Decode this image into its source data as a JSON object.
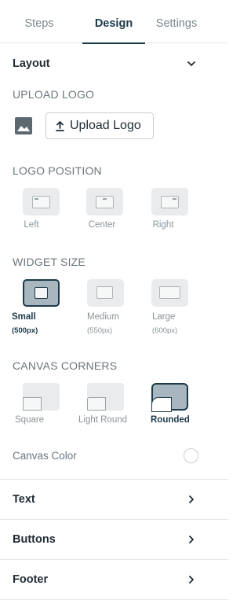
{
  "tabs": [
    {
      "label": "Steps",
      "active": false
    },
    {
      "label": "Design",
      "active": true
    },
    {
      "label": "Settings",
      "active": false
    }
  ],
  "layout_section": {
    "label": "Layout",
    "icon": "chevron-down-icon",
    "expanded": true
  },
  "upload_logo": {
    "heading": "UPLOAD LOGO",
    "image_icon": "image-icon",
    "button_label": "Upload Logo",
    "button_icon": "upload-icon"
  },
  "logo_position": {
    "heading": "LOGO POSITION",
    "options": [
      {
        "label": "Left",
        "selected": false
      },
      {
        "label": "Center",
        "selected": false
      },
      {
        "label": "Right",
        "selected": false
      }
    ]
  },
  "widget_size": {
    "heading": "WIDGET SIZE",
    "options": [
      {
        "label": "Small",
        "sub": "(500px)",
        "selected": true
      },
      {
        "label": "Medium",
        "sub": "(550px)",
        "selected": false
      },
      {
        "label": "Large",
        "sub": "(600px)",
        "selected": false
      }
    ]
  },
  "canvas_corners": {
    "heading": "CANVAS CORNERS",
    "options": [
      {
        "label": "Square",
        "selected": false
      },
      {
        "label": "Light Round",
        "selected": false
      },
      {
        "label": "Rounded",
        "selected": true
      }
    ]
  },
  "canvas_color": {
    "label": "Canvas Color"
  },
  "sections": [
    {
      "label": "Text",
      "icon": "chevron-right-icon"
    },
    {
      "label": "Buttons",
      "icon": "chevron-right-icon"
    },
    {
      "label": "Footer",
      "icon": "chevron-right-icon"
    }
  ],
  "colors": {
    "accent": "#1d3a4a",
    "selected_fill": "#a8b6bf",
    "option_fill": "#e9ebec",
    "divider": "#e3e6e8"
  }
}
